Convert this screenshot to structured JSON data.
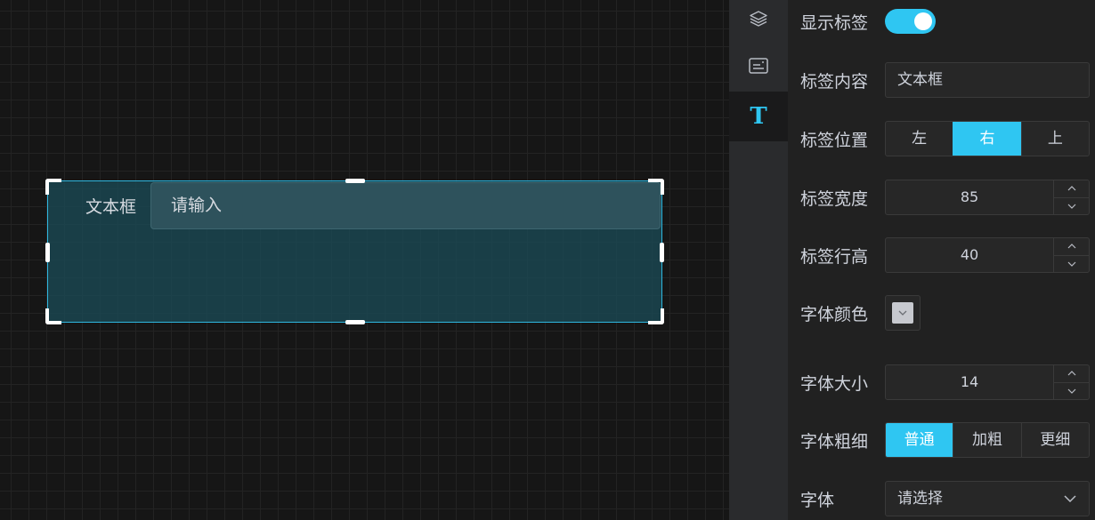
{
  "canvas": {
    "widget": {
      "label": "文本框",
      "input_placeholder": "请输入"
    }
  },
  "iconbar": {
    "items": [
      {
        "name": "layers",
        "icon": "layers-icon"
      },
      {
        "name": "component",
        "icon": "card-icon"
      },
      {
        "name": "text",
        "icon": "text-icon",
        "glyph": "T",
        "active": true
      }
    ]
  },
  "panel": {
    "show_label": {
      "label": "显示标签",
      "on": true
    },
    "label_content": {
      "label": "标签内容",
      "value": "文本框"
    },
    "label_position": {
      "label": "标签位置",
      "options": [
        "左",
        "右",
        "上"
      ],
      "selected": "右"
    },
    "label_width": {
      "label": "标签宽度",
      "value": "85"
    },
    "label_line_height": {
      "label": "标签行高",
      "value": "40"
    },
    "font_color": {
      "label": "字体颜色",
      "value": "#c7c9cf"
    },
    "font_size": {
      "label": "字体大小",
      "value": "14"
    },
    "font_weight": {
      "label": "字体粗细",
      "options": [
        "普通",
        "加粗",
        "更细"
      ],
      "selected": "普通"
    },
    "font_family": {
      "label": "字体",
      "placeholder": "请选择"
    }
  },
  "colors": {
    "accent": "#2fc6f2",
    "selection_border": "#2fb7e0"
  }
}
